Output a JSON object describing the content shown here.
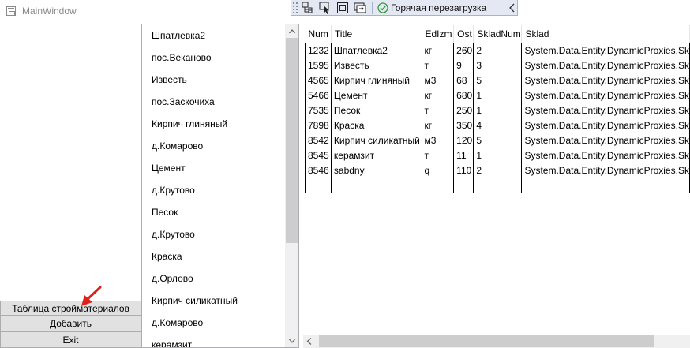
{
  "window": {
    "title": "MainWindow"
  },
  "debug_toolbar": {
    "hot_reload_label": "Горячая перезагрузка",
    "buttons": [
      "live-visual-tree-icon",
      "select-element-icon",
      "display-layout-adorners-icon",
      "track-focus-icon"
    ]
  },
  "left_buttons": {
    "table": "Таблица стройматериалов",
    "add": "Добавить",
    "exit": "Exit"
  },
  "list": {
    "items": [
      "Шпатлевка2",
      "пос.Веканово",
      "Известь",
      "пос.Заскочиха",
      "Кирпич глиняный",
      "д.Комарово",
      "Цемент",
      "д.Крутово",
      "Песок",
      "д.Крутово",
      "Краска",
      "д.Орлово",
      "Кирпич силикатный",
      "д.Комарово",
      "керамзит"
    ]
  },
  "grid": {
    "columns": [
      "Num",
      "Title",
      "EdIzm",
      "Ost",
      "SkladNum",
      "Sklad"
    ],
    "rows": [
      [
        "1232",
        "Шпатлевка2",
        "кг",
        "260",
        "2",
        "System.Data.Entity.DynamicProxies.Sk"
      ],
      [
        "1595",
        "Известь",
        "т",
        "9",
        "3",
        "System.Data.Entity.DynamicProxies.Sk"
      ],
      [
        "4565",
        "Кирпич глиняный",
        "м3",
        "68",
        "5",
        "System.Data.Entity.DynamicProxies.Sk"
      ],
      [
        "5466",
        "Цемент",
        "кг",
        "680",
        "1",
        "System.Data.Entity.DynamicProxies.Sk"
      ],
      [
        "7535",
        "Песок",
        "т",
        "250",
        "1",
        "System.Data.Entity.DynamicProxies.Sk"
      ],
      [
        "7898",
        "Краска",
        "кг",
        "350",
        "4",
        "System.Data.Entity.DynamicProxies.Sk"
      ],
      [
        "8542",
        "Кирпич силикатный",
        "м3",
        "120",
        "5",
        "System.Data.Entity.DynamicProxies.Sk"
      ],
      [
        "8545",
        "керамзит",
        "т",
        "11",
        "1",
        "System.Data.Entity.DynamicProxies.Sk"
      ],
      [
        "8546",
        "sabdny",
        "q",
        "110",
        "2",
        "System.Data.Entity.DynamicProxies.Sk"
      ],
      [
        "",
        "",
        "",
        "",
        "",
        ""
      ]
    ]
  },
  "colors": {
    "annotation_arrow": "#e0201a",
    "check": "#2e9b3a"
  }
}
